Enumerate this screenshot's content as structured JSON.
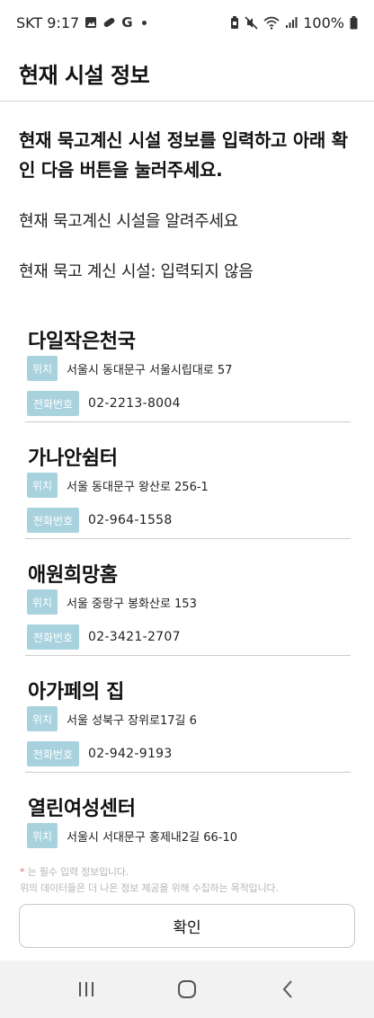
{
  "status_bar": {
    "carrier_time": "SKT 9:17",
    "battery": "100%",
    "icons": [
      "gallery-icon",
      "pill-icon",
      "google-icon",
      "dot-icon",
      "battery-saver-icon",
      "mute-icon",
      "wifi-icon",
      "signal-icon",
      "battery-icon"
    ],
    "g_glyph": "G"
  },
  "header": {
    "title": "현재 시설 정보"
  },
  "intro": {
    "heading": "현재 묵고계신 시설 정보를 입력하고 아래 확인 다음 버튼을 눌러주세요.",
    "prompt": "현재 묵고계신 시설을 알려주세요",
    "current": "현재 묵고 계신 시설: 입력되지 않음"
  },
  "labels": {
    "location": "위치",
    "phone": "전화번호"
  },
  "facilities": [
    {
      "name": "다일작은천국",
      "location": "서울시 동대문구 서울시립대로 57",
      "phone": "02-2213-8004"
    },
    {
      "name": "가나안쉼터",
      "location": "서울 동대문구 왕산로 256-1",
      "phone": "02-964-1558"
    },
    {
      "name": "애원희망홈",
      "location": "서울 중랑구 봉화산로 153",
      "phone": "02-3421-2707"
    },
    {
      "name": "아가페의 집",
      "location": "서울 성북구 장위로17길 6",
      "phone": "02-942-9193"
    },
    {
      "name": "열린여성센터",
      "location": "서울시 서대문구 홍제내2길 66-10",
      "phone": ""
    }
  ],
  "notes": {
    "required_star": "*",
    "required": " 는 필수 입력 정보입니다.",
    "purpose": "위의 데이터들은 더 나은 정보 제공을 위해 수집하는 목적입니다."
  },
  "confirm_button": "확인",
  "nav": {
    "buttons": [
      "recent-apps-icon",
      "home-icon",
      "back-icon"
    ]
  },
  "colors": {
    "tag": "#a9d2df",
    "divider": "#cccccc",
    "note": "#b5b5b5",
    "nav_bg": "#f2f2f2"
  }
}
